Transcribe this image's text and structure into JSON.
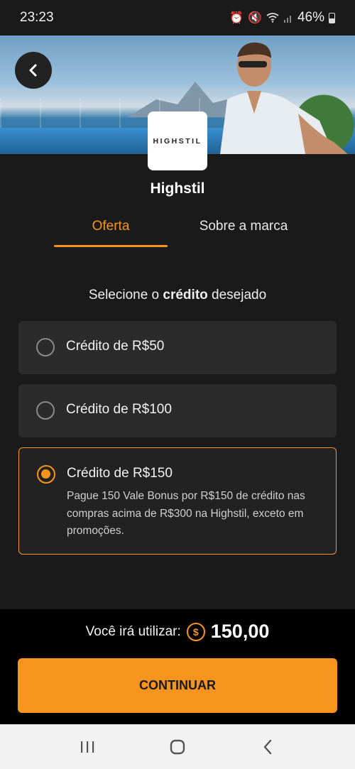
{
  "status_bar": {
    "time": "23:23",
    "battery": "46%"
  },
  "brand": {
    "logo_text": "HIGHSTIL",
    "name": "Highstil"
  },
  "tabs": [
    {
      "label": "Oferta"
    },
    {
      "label": "Sobre a marca"
    }
  ],
  "prompt": {
    "prefix": "Selecione o ",
    "bold": "crédito",
    "suffix": " desejado"
  },
  "options": [
    {
      "label": "Crédito de R$50"
    },
    {
      "label": "Crédito de R$100"
    },
    {
      "label": "Crédito de R$150",
      "description": "Pague 150 Vale Bonus por R$150 de crédito nas compras acima de R$300 na Highstil, exceto em promoções."
    }
  ],
  "summary": {
    "label": "Você irá utilizar:",
    "value": "150,00",
    "coin_symbol": "$"
  },
  "actions": {
    "continue_label": "CONTINUAR"
  },
  "colors": {
    "accent": "#f7941d",
    "background": "#1a1a1a",
    "card": "#2b2b2b"
  }
}
